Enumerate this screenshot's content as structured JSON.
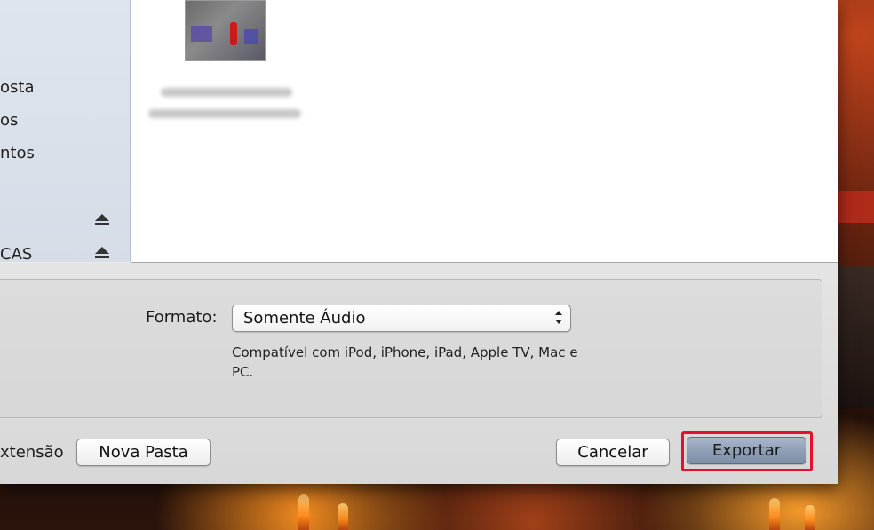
{
  "sidebar": {
    "items": [
      {
        "label": "osta"
      },
      {
        "label": "os"
      },
      {
        "label": "ntos"
      },
      {
        "label": "CAS"
      }
    ]
  },
  "export_panel": {
    "format_label": "Formato:",
    "format_value": "Somente Áudio",
    "format_description": "Compatível com iPod, iPhone, iPad, Apple TV, Mac e PC."
  },
  "footer": {
    "extension_label": "xtensão",
    "new_folder_label": "Nova Pasta",
    "cancel_label": "Cancelar",
    "export_label": "Exportar"
  },
  "colors": {
    "highlight": "#e2112e",
    "primary_button": "#8e9fb6"
  }
}
